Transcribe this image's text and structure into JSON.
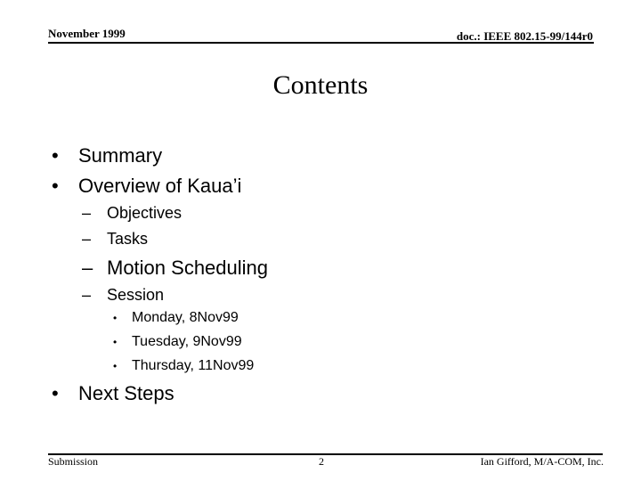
{
  "header": {
    "date": "November 1999",
    "doc_id": "doc.: IEEE 802.15-99/144r0"
  },
  "title": "Contents",
  "icons": {
    "bullet": "•",
    "dash": "–",
    "small_bullet": "•"
  },
  "outline": {
    "summary": "Summary",
    "overview": "Overview of Kaua’i",
    "objectives": "Objectives",
    "tasks": "Tasks",
    "motion_scheduling": "Motion Scheduling",
    "session": "Session",
    "sessions": [
      "Monday, 8Nov99",
      "Tuesday, 9Nov99",
      "Thursday, 11Nov99"
    ],
    "next_steps": "Next Steps"
  },
  "footer": {
    "left": "Submission",
    "page_number": "2",
    "author": "Ian Gifford, M/A-COM, Inc."
  }
}
